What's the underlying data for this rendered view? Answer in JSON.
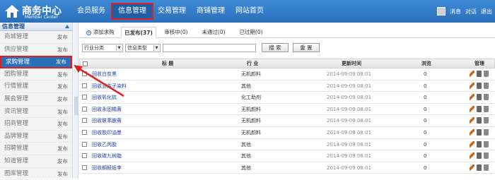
{
  "header": {
    "logo_title": "商务中心",
    "logo_sub": "Member Center",
    "nav": [
      {
        "label": "会员服务",
        "active": false
      },
      {
        "label": "信息管理",
        "active": true
      },
      {
        "label": "交易管理",
        "active": false
      },
      {
        "label": "商铺管理",
        "active": false
      },
      {
        "label": "网站首页",
        "active": false
      }
    ],
    "user_links": [
      "消息",
      "对话",
      "退出"
    ]
  },
  "sidebar": {
    "title": "信息管理",
    "items": [
      {
        "label": "商城管理",
        "action": "发布"
      },
      {
        "label": "供应管理",
        "action": "发布"
      },
      {
        "label": "求购管理",
        "action": "发布",
        "active": true
      },
      {
        "label": "团购管理",
        "action": "发布"
      },
      {
        "label": "行情管理",
        "action": "发布"
      },
      {
        "label": "展会管理",
        "action": "发布"
      },
      {
        "label": "资讯管理",
        "action": "发布"
      },
      {
        "label": "招商管理",
        "action": "发布"
      },
      {
        "label": "品牌管理",
        "action": "发布"
      },
      {
        "label": "招聘管理",
        "action": "发布"
      },
      {
        "label": "知道管理",
        "action": "发布"
      },
      {
        "label": "图库管理",
        "action": "发布"
      }
    ]
  },
  "tabs": {
    "add": "添加求购",
    "published": "已发布(37)",
    "pending": "审核中(0)",
    "rejected": "未通过(0)",
    "expired": "已过期(0)"
  },
  "filters": {
    "industry": "行业分类",
    "type": "信息类型",
    "keyword": "",
    "search": "搜 索",
    "reset": "重 置"
  },
  "table": {
    "headers": {
      "title": "标 题",
      "industry": "行 业",
      "updated": "更新时间",
      "views": "浏览",
      "manage": "管理"
    },
    "rows": [
      {
        "title": "回收白炭黑",
        "industry": "无机颜料",
        "updated": "2014-09-09 08:01",
        "views": "0"
      },
      {
        "title": "回收亚苏子染料",
        "industry": "其他",
        "updated": "2014-09-09 08:01",
        "views": "0"
      },
      {
        "title": "回收氧化钪",
        "industry": "化工助剂",
        "updated": "2014-09-09 08:01",
        "views": "0"
      },
      {
        "title": "回收永固橘黄",
        "industry": "无机颜料",
        "updated": "2014-09-09 08:01",
        "views": "0"
      },
      {
        "title": "回收联苯胺黄",
        "industry": "无机颜料",
        "updated": "2014-09-09 08:01",
        "views": "0"
      },
      {
        "title": "回收胶印油墨",
        "industry": "无机颜料",
        "updated": "2014-09-09 08:01",
        "views": "0"
      },
      {
        "title": "回收乙丙胶",
        "industry": "其他",
        "updated": "2014-09-09 08:01",
        "views": "0"
      },
      {
        "title": "回收碳九树脂",
        "industry": "其他",
        "updated": "2014-09-09 08:01",
        "views": "0"
      },
      {
        "title": "回收酮醛纸李",
        "industry": "其他",
        "updated": "2014-09-09 08:01",
        "views": "0"
      }
    ]
  },
  "colors": {
    "header_blue": "#2a6fba",
    "highlight_red": "#e02020",
    "link_blue": "#1c3f9e"
  }
}
